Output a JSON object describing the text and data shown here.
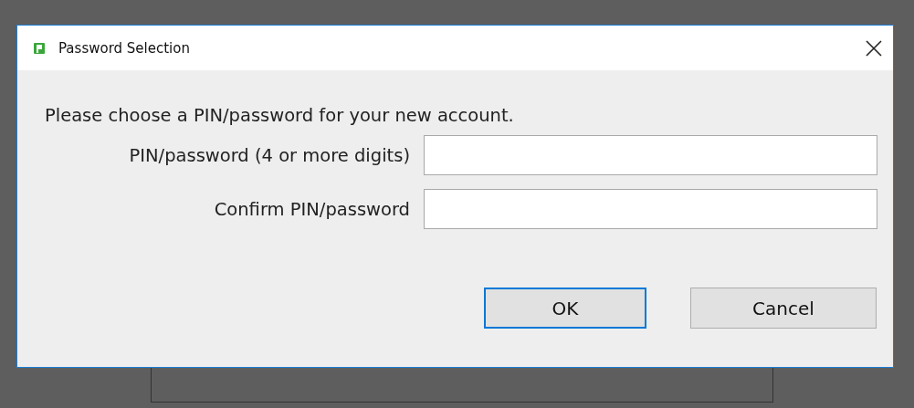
{
  "window": {
    "title": "Password Selection"
  },
  "message": "Please choose a PIN/password for your new account.",
  "fields": [
    {
      "label": "PIN/password (4 or more digits)"
    },
    {
      "label": "Confirm PIN/password"
    }
  ],
  "buttons": [
    {
      "label": "OK",
      "default": true
    },
    {
      "label": "Cancel",
      "default": false
    }
  ]
}
